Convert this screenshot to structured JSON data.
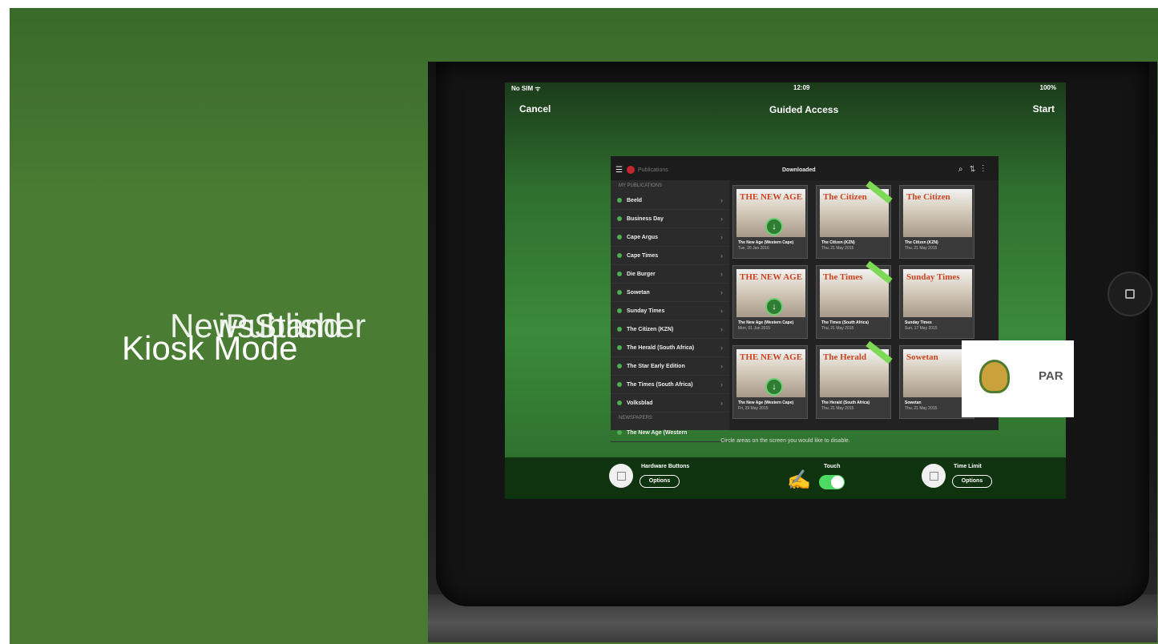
{
  "slide": {
    "titles": [
      "Kiosk Mode",
      "NewsStand",
      "iPublisher"
    ]
  },
  "status": {
    "carrier": "No SIM ᯤ",
    "time": "12:09",
    "battery": "100%"
  },
  "guided_access": {
    "cancel": "Cancel",
    "title": "Guided Access",
    "start": "Start"
  },
  "app": {
    "section": "Publications",
    "title": "Downloaded",
    "sidebar_header": "MY PUBLICATIONS",
    "publications": [
      "Beeld",
      "Business Day",
      "Cape Argus",
      "Cape Times",
      "Die Burger",
      "Sowetan",
      "Sunday Times",
      "The Citizen (KZN)",
      "The Herald (South Africa)",
      "The Star Early Edition",
      "The Times (South Africa)",
      "Volksblad"
    ],
    "newspapers_header": "NEWSPAPERS",
    "last_item": "The New Age (Western",
    "cards": [
      {
        "mast": "THE NEW AGE",
        "title": "The New Age (Western Cape)",
        "date": "Tue, 26 Jan 2016"
      },
      {
        "mast": "The Citizen",
        "title": "The Citizen (KZN)",
        "date": "Thu, 21 May 2015"
      },
      {
        "mast": "The Citizen",
        "title": "The Citizen (KZN)",
        "date": "Thu, 21 May 2015"
      },
      {
        "mast": "THE NEW AGE",
        "title": "The New Age (Western Cape)",
        "date": "Mon, 01 Jun 2015"
      },
      {
        "mast": "The Times",
        "title": "The Times (South Africa)",
        "date": "Thu, 21 May 2015"
      },
      {
        "mast": "Sunday Times",
        "title": "Sunday Times",
        "date": "Sun, 17 May 2015"
      },
      {
        "mast": "THE NEW AGE",
        "title": "The New Age (Western Cape)",
        "date": "Fri, 29 May 2015"
      },
      {
        "mast": "The Herald",
        "title": "The Herald (South Africa)",
        "date": "Thu, 21 May 2015"
      },
      {
        "mast": "Sowetan",
        "title": "Sowetan",
        "date": "Thu, 21 May 2015"
      }
    ]
  },
  "parliament_text": "PAR",
  "hint": "Circle areas on the screen you would like to disable.",
  "options": {
    "hardware": "Hardware Buttons",
    "touch": "Touch",
    "time_limit": "Time Limit",
    "options_btn": "Options"
  },
  "colors": {
    "slide_green": "#4a7c33",
    "toggle_on": "#4cd964",
    "download_green": "#2e7d32"
  }
}
